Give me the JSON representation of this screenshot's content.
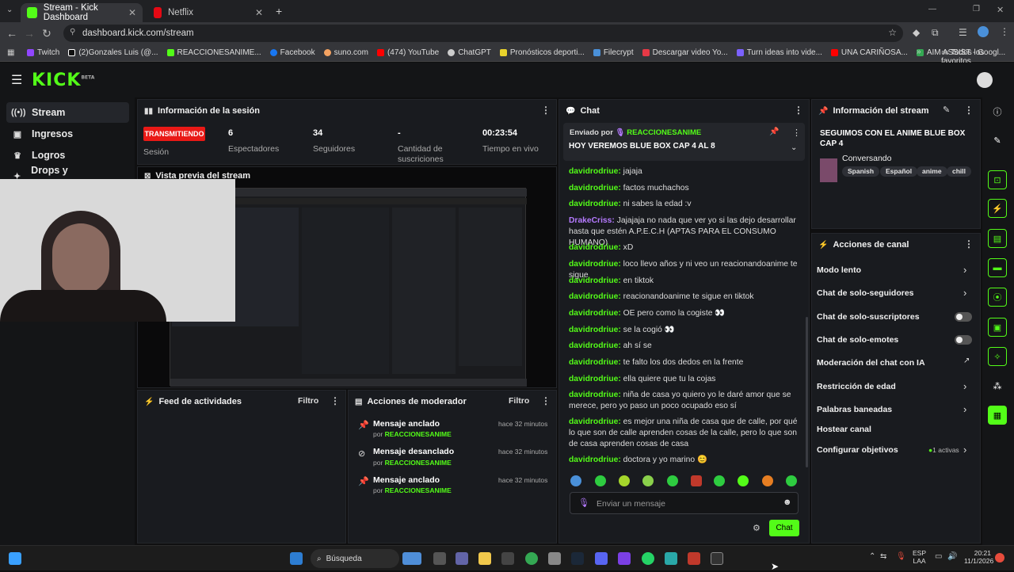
{
  "browser": {
    "tabs": [
      {
        "label": "Stream - Kick Dashboard"
      },
      {
        "label": "Netflix"
      }
    ],
    "url": "dashboard.kick.com/stream",
    "bookmarks": [
      "Twitch",
      "(2)Gonzales Luis (@...",
      "REACCIONESANIME...",
      "Facebook",
      "suno.com",
      "(474) YouTube",
      "ChatGPT",
      "Pronósticos deporti...",
      "Filecrypt",
      "Descargar video Yo...",
      "Turn ideas into vide...",
      "UNA CARIÑOSA...",
      "AIM ASSIST - Googl..."
    ],
    "all_favorites": "Todos los favoritos"
  },
  "brand": {
    "logo": "KICK",
    "beta": "BETA",
    "accent": "#53fc18"
  },
  "sidebar": {
    "items": [
      {
        "label": "Stream",
        "icon": "broadcast-icon"
      },
      {
        "label": "Ingresos",
        "icon": "money-icon"
      },
      {
        "label": "Logros",
        "icon": "trophy-icon"
      },
      {
        "label": "Drops y recompensas",
        "icon": "gift-icon"
      }
    ]
  },
  "session": {
    "title": "Información de la sesión",
    "live_badge": "TRANSMITIENDO",
    "stats": [
      {
        "value": "",
        "label": "Sesión"
      },
      {
        "value": "6",
        "label": "Espectadores"
      },
      {
        "value": "34",
        "label": "Seguidores"
      },
      {
        "value": "-",
        "label": "Cantidad de suscriciones"
      },
      {
        "value": "00:23:54",
        "label": "Tiempo en vivo"
      }
    ]
  },
  "preview": {
    "title": "Vista previa del stream"
  },
  "activity": {
    "title": "Feed de actividades",
    "filter": "Filtro"
  },
  "modactions": {
    "title": "Acciones de moderador",
    "filter": "Filtro",
    "items": [
      {
        "action": "Mensaje anclado",
        "by": "por",
        "user": "REACCIONESANIME",
        "time": "hace 32 minutos"
      },
      {
        "action": "Mensaje desanclado",
        "by": "por",
        "user": "REACCIONESANIME",
        "time": "hace 32 minutos"
      },
      {
        "action": "Mensaje anclado",
        "by": "por",
        "user": "REACCIONESANIME",
        "time": "hace 32 minutos"
      }
    ]
  },
  "chat": {
    "title": "Chat",
    "pinned_by": "Enviado por",
    "pinned_user": "REACCIONESANIME",
    "pinned_text": "HOY VEREMOS BLUE BOX CAP 4 AL 8",
    "messages": [
      {
        "user": "davidrodriue:",
        "text": "jajaja"
      },
      {
        "user": "davidrodriue:",
        "text": "factos muchachos"
      },
      {
        "user": "davidrodriue:",
        "text": "ni sabes la edad :v"
      },
      {
        "user": "DrakeCriss:",
        "text": "Jajajaja no nada que ver yo si las dejo desarrollar hasta que estén A.P.E.C.H (APTAS PARA EL CONSUMO HUMANO)"
      },
      {
        "user": "davidrodriue:",
        "text": "xD"
      },
      {
        "user": "davidrodriue:",
        "text": "loco llevo años y ni veo un reacionandoanime te sigue"
      },
      {
        "user": "davidrodriue:",
        "text": "en tiktok"
      },
      {
        "user": "davidrodriue:",
        "text": "reacionandoanime te sigue en tiktok"
      },
      {
        "user": "davidrodriue:",
        "text": "OE pero como la cogiste 👀"
      },
      {
        "user": "davidrodriue:",
        "text": "se la cogió 👀"
      },
      {
        "user": "davidrodriue:",
        "text": "ah sí se"
      },
      {
        "user": "davidrodriue:",
        "text": "te falto los dos dedos en la frente"
      },
      {
        "user": "davidrodriue:",
        "text": "ella quiere que tu la cojas"
      },
      {
        "user": "davidrodriue:",
        "text": "niña de casa yo quiero yo le daré amor que se merece, pero yo paso un poco ocupado eso sí"
      },
      {
        "user": "davidrodriue:",
        "text": "es mejor una niña de casa que de calle, por qué lo que son de calle aprenden cosas de la calle, pero lo que son de casa aprenden cosas de casa"
      },
      {
        "user": "davidrodriue:",
        "text": "doctora y yo marino 😊"
      }
    ],
    "input_placeholder": "Enviar un mensaje",
    "send": "Chat"
  },
  "streaminfo": {
    "title": "Información del stream",
    "stream_title": "SEGUIMOS CON EL ANIME BLUE BOX CAP 4",
    "category": "Conversando",
    "tags": [
      "Spanish",
      "Español",
      "anime",
      "chill"
    ]
  },
  "channel": {
    "title": "Acciones de canal",
    "actions": [
      {
        "label": "Modo lento",
        "ctrl": "chevron"
      },
      {
        "label": "Chat de solo-seguidores",
        "ctrl": "chevron"
      },
      {
        "label": "Chat de solo-suscriptores",
        "ctrl": "toggle"
      },
      {
        "label": "Chat de solo-emotes",
        "ctrl": "toggle"
      },
      {
        "label": "Moderación del chat con IA",
        "ctrl": "external"
      },
      {
        "label": "Restricción de edad",
        "ctrl": "chevron"
      },
      {
        "label": "Palabras baneadas",
        "ctrl": "chevron"
      },
      {
        "label": "Hostear canal",
        "ctrl": "none"
      },
      {
        "label": "Configurar objetivos",
        "ctrl": "chevron"
      }
    ],
    "goals_active": "1 activas"
  },
  "taskbar": {
    "search": "Búsqueda",
    "lang": "ESP",
    "lang2": "LAA",
    "time": "20:21",
    "date": "11/1/2026"
  }
}
